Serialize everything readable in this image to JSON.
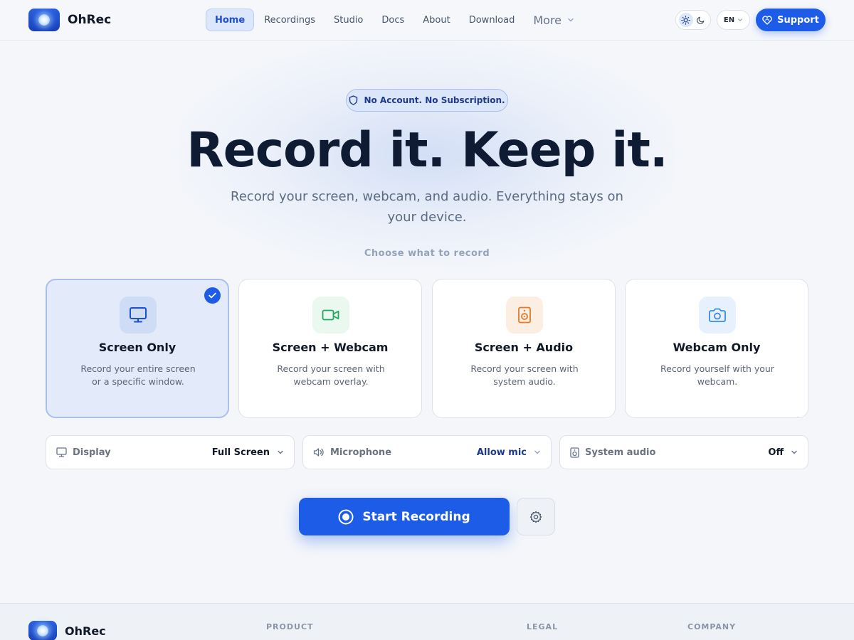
{
  "header": {
    "brand": "OhRec",
    "nav": [
      "Home",
      "Recordings",
      "Studio",
      "Docs",
      "About",
      "Download"
    ],
    "nav_more": "More",
    "language": "EN",
    "support_label": "Support"
  },
  "hero": {
    "badge": "No Account. No Subscription.",
    "title": "Record it. Keep it.",
    "subtitle": "Record your screen, webcam, and audio. Everything stays on your device.",
    "choose_label": "Choose what to record"
  },
  "modes": [
    {
      "title": "Screen Only",
      "description": "Record your entire screen or a specific window.",
      "icon": "monitor-icon",
      "selected": true
    },
    {
      "title": "Screen + Webcam",
      "description": "Record your screen with webcam overlay.",
      "icon": "video-camera-icon",
      "selected": false
    },
    {
      "title": "Screen + Audio",
      "description": "Record your screen with system audio.",
      "icon": "speaker-icon",
      "selected": false
    },
    {
      "title": "Webcam Only",
      "description": "Record yourself with your webcam.",
      "icon": "camera-icon",
      "selected": false
    }
  ],
  "options": {
    "display": {
      "label": "Display",
      "value": "Full Screen"
    },
    "microphone": {
      "label": "Microphone",
      "value": "Allow mic"
    },
    "system_audio": {
      "label": "System audio",
      "value": "Off"
    }
  },
  "actions": {
    "start_label": "Start Recording"
  },
  "footer": {
    "brand": "OhRec",
    "columns": [
      "PRODUCT",
      "LEGAL",
      "COMPANY"
    ]
  },
  "colors": {
    "accent": "#1d5ce6",
    "selected_card_bg": "#e3eafa",
    "webcam_icon_bg": "#eaf8ef",
    "audio_icon_bg": "#fdeee2",
    "camera_icon_bg": "#e7f1fd"
  }
}
